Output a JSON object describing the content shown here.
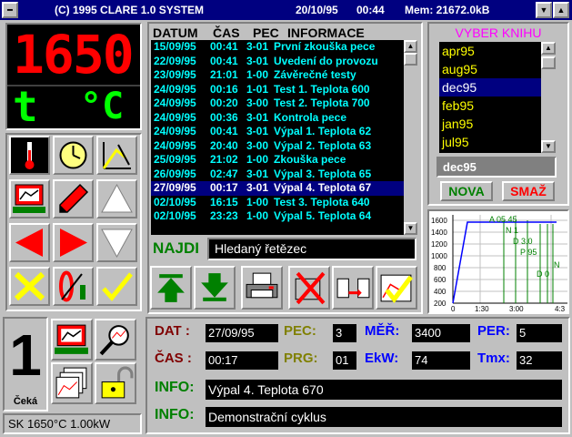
{
  "window": {
    "title_left": "(C) 1995 CLARE 1.0 SYSTEM",
    "date": "20/10/95",
    "time": "00:44",
    "mem": "Mem: 21672.0kB"
  },
  "display": {
    "temperature": "1650",
    "t_symbol": "t",
    "unit": "°C",
    "colors": {
      "temp": "#ff0000",
      "unit": "#00ff00"
    }
  },
  "tool_icons": [
    "thermometer-icon",
    "clock-icon",
    "graph-icon",
    "monitor-icon",
    "pencil-icon",
    "arrow-up-icon",
    "arrow-left-icon",
    "arrow-right-icon",
    "arrow-down-icon",
    "close-x-icon",
    "switch-icon",
    "checkmark-icon"
  ],
  "log": {
    "headers": [
      "DATUM",
      "ČAS",
      "PEC",
      "INFORMACE"
    ],
    "rows": [
      {
        "date": "15/09/95",
        "time": "00:41",
        "pec": "3-01",
        "info": "První zkouška pece"
      },
      {
        "date": "22/09/95",
        "time": "00:41",
        "pec": "3-01",
        "info": "Uvedení do provozu"
      },
      {
        "date": "23/09/95",
        "time": "21:01",
        "pec": "1-00",
        "info": "Závěrečné testy"
      },
      {
        "date": "24/09/95",
        "time": "00:16",
        "pec": "1-01",
        "info": "Test 1. Teplota 600"
      },
      {
        "date": "24/09/95",
        "time": "00:20",
        "pec": "3-00",
        "info": "Test 2. Teplota 700"
      },
      {
        "date": "24/09/95",
        "time": "00:36",
        "pec": "3-01",
        "info": "Kontrola pece"
      },
      {
        "date": "24/09/95",
        "time": "00:41",
        "pec": "3-01",
        "info": "Výpal 1. Teplota 62"
      },
      {
        "date": "24/09/95",
        "time": "20:40",
        "pec": "3-00",
        "info": "Výpal 2. Teplota 63"
      },
      {
        "date": "25/09/95",
        "time": "21:02",
        "pec": "1-00",
        "info": "Zkouška pece"
      },
      {
        "date": "26/09/95",
        "time": "02:47",
        "pec": "3-01",
        "info": "Výpal 3. Teplota 65"
      },
      {
        "date": "27/09/95",
        "time": "00:17",
        "pec": "3-01",
        "info": "Výpal 4. Teplota 67",
        "selected": true
      },
      {
        "date": "02/10/95",
        "time": "16:15",
        "pec": "1-00",
        "info": "Test 3. Teplota 640"
      },
      {
        "date": "02/10/95",
        "time": "23:23",
        "pec": "1-00",
        "info": "Výpal 5. Teplota 64"
      }
    ]
  },
  "search": {
    "label": "NAJDI",
    "placeholder": "Hledaný řetězec"
  },
  "log_tools": [
    "jump-top-icon",
    "jump-bottom-icon",
    "printer-icon",
    "delete-icon",
    "export-icon",
    "confirm-chart-icon"
  ],
  "book": {
    "title": "VYBER KNIHU",
    "months": [
      "apr95",
      "aug95",
      "dec95",
      "feb95",
      "jan95",
      "jul95"
    ],
    "selected_index": 2,
    "current": "dec95",
    "new_label": "NOVA",
    "delete_label": "SMAŽ"
  },
  "graph": {
    "y_ticks": [
      "1600",
      "1400",
      "1200",
      "1000",
      "800",
      "600",
      "400",
      "200"
    ],
    "x_ticks": [
      "0",
      "1:30",
      "3:00",
      "4:3"
    ],
    "labels": [
      "A 05.45",
      "N 1",
      "D 3.0",
      "P 95",
      "N",
      "D 0"
    ]
  },
  "status": {
    "number": "1",
    "state": "Čeká",
    "footer": "SK 1650°C 1.00kW"
  },
  "status_icons": [
    "monitor-icon",
    "magnifier-icon",
    "layers-icon",
    "unlock-icon"
  ],
  "details": {
    "dat_label": "DAT :",
    "dat": "27/09/95",
    "pec_label": "PEC:",
    "pec": "3",
    "mer_label": "MĚŘ:",
    "mer": "3400",
    "per_label": "PER:",
    "per": "5",
    "cas_label": "ČAS :",
    "cas": "00:17",
    "prg_label": "PRG:",
    "prg": "01",
    "ekw_label": "EkW:",
    "ekw": "74",
    "tmx_label": "Tmx:",
    "tmx": "32",
    "info1_label": "INFO:",
    "info1": "Výpal 4. Teplota 670",
    "info2_label": "INFO:",
    "info2": "Demonstrační cyklus"
  }
}
